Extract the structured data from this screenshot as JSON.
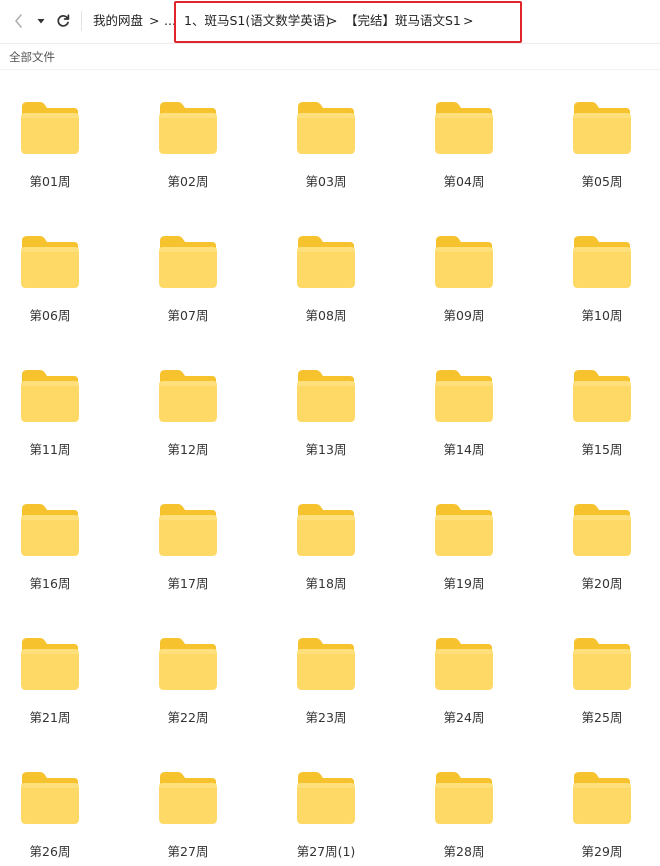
{
  "breadcrumb": {
    "root": "我的网盘",
    "ellipsis": "...",
    "folder1": "1、斑马S1(语文数学英语)",
    "folder2": "【完结】斑马语文S1",
    "separator": ">"
  },
  "section_label": "全部文件",
  "folders": [
    "第01周",
    "第02周",
    "第03周",
    "第04周",
    "第05周",
    "第06周",
    "第07周",
    "第08周",
    "第09周",
    "第10周",
    "第11周",
    "第12周",
    "第13周",
    "第14周",
    "第15周",
    "第16周",
    "第17周",
    "第18周",
    "第19周",
    "第20周",
    "第21周",
    "第22周",
    "第23周",
    "第24周",
    "第25周",
    "第26周",
    "第27周",
    "第27周(1)",
    "第28周",
    "第29周"
  ],
  "colors": {
    "folder_back": "#f6c22d",
    "folder_front": "#ffd966",
    "highlight": "#e0252b"
  },
  "icons": {
    "back": "chevron-left-icon",
    "dropdown": "caret-down-icon",
    "refresh": "refresh-icon",
    "folder": "folder-icon"
  }
}
